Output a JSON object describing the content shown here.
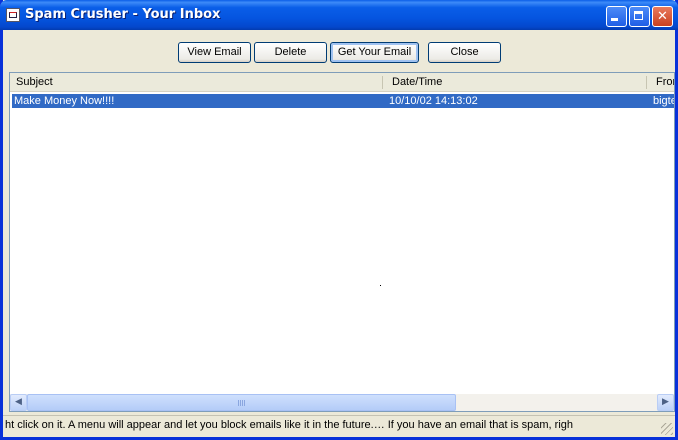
{
  "window": {
    "title": "Spam Crusher - Your Inbox"
  },
  "toolbar": {
    "view_email": "View Email",
    "delete": "Delete",
    "get_your_email": "Get Your Email",
    "close": "Close"
  },
  "list": {
    "columns": [
      "Subject",
      "Date/Time",
      "From"
    ],
    "rows": [
      {
        "subject": "Make Money Now!!!!",
        "datetime": "10/10/02 14:13:02",
        "from": "bigte"
      }
    ]
  },
  "status": {
    "text": "ht click on it.  A menu will appear and let you block emails like it in the future.…  If you have an email that is spam, righ"
  },
  "colors": {
    "titlebar": "#0a5ee8",
    "selection": "#316ac5",
    "close_button": "#c9401f"
  },
  "icons": [
    "app-icon",
    "minimize-icon",
    "maximize-icon",
    "close-icon",
    "scroll-left-icon",
    "scroll-right-icon",
    "resize-grip-icon"
  ]
}
